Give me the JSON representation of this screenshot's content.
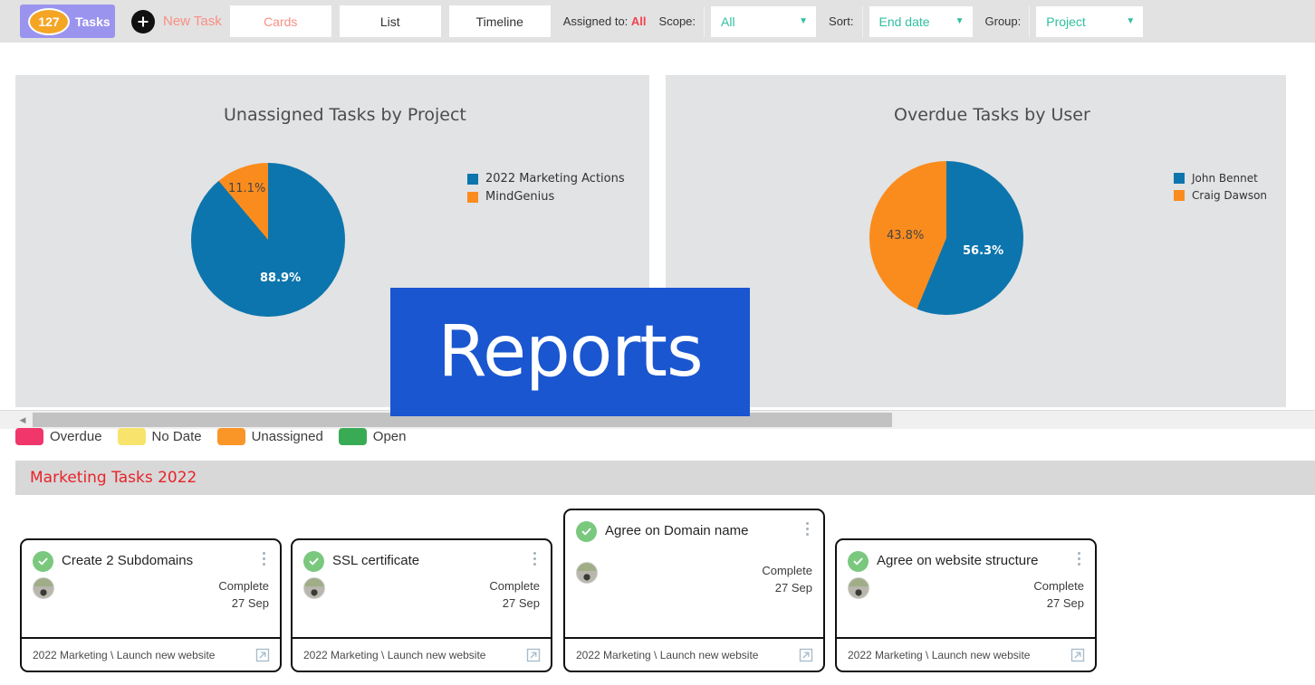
{
  "toolbar": {
    "tasks_count": "127",
    "tasks_label": "Tasks",
    "plus_icon": "plus-icon",
    "new_task_label": "New Task",
    "views": [
      {
        "label": "Cards",
        "active": true
      },
      {
        "label": "List",
        "active": false
      },
      {
        "label": "Timeline",
        "active": false
      }
    ],
    "assigned_to_label": "Assigned to:",
    "assigned_to_value": "All",
    "scope_label": "Scope:",
    "scope_value": "All",
    "sort_label": "Sort:",
    "sort_value": "End date",
    "group_label": "Group:",
    "group_value": "Project",
    "caret_icon": "chevron-down-icon",
    "colors": {
      "bar": "#e2e2e2",
      "badge": "#9b94ee",
      "count_circle": "#f5a524",
      "accent_salmon": "#fa8f84",
      "accent_red": "#f4414e",
      "select_text": "#2fbfa0"
    }
  },
  "chart_data": [
    {
      "type": "pie",
      "title": "Unassigned Tasks by Project",
      "labels": [
        "2022 Marketing Actions",
        "MindGenius"
      ],
      "values": [
        88.9,
        11.1
      ],
      "value_labels": [
        "88.9%",
        "11.1%"
      ],
      "colors": [
        "#0d75ad",
        "#fa8c1e"
      ],
      "legend_position": "right",
      "grid": false
    },
    {
      "type": "pie",
      "title": "Overdue Tasks by User",
      "labels": [
        "John Bennet",
        "Craig Dawson"
      ],
      "values": [
        56.3,
        43.8
      ],
      "value_labels": [
        "56.3%",
        "43.8%"
      ],
      "colors": [
        "#0d75ad",
        "#fa8c1e"
      ],
      "legend_position": "right",
      "grid": false
    }
  ],
  "overlay": {
    "text": "Reports",
    "color": "#1a56cf"
  },
  "scrollbar": {
    "left_arrow_icon": "caret-left-icon"
  },
  "status_legend": [
    {
      "label": "Overdue",
      "color": "#f0366b"
    },
    {
      "label": "No Date",
      "color": "#f8e46c"
    },
    {
      "label": "Unassigned",
      "color": "#f99627"
    },
    {
      "label": "Open",
      "color": "#3aab55"
    }
  ],
  "group": {
    "title": "Marketing Tasks 2022"
  },
  "cards": [
    {
      "title": "Create 2 Subdomains",
      "status": "Complete",
      "date": "27 Sep",
      "path": "2022 Marketing \\ Launch new website",
      "check_icon": "check-circle-icon",
      "kebab_icon": "more-vertical-icon",
      "open_icon": "open-external-icon",
      "avatar_icon": "avatar"
    },
    {
      "title": "SSL certificate",
      "status": "Complete",
      "date": "27 Sep",
      "path": "2022 Marketing \\ Launch new website",
      "check_icon": "check-circle-icon",
      "kebab_icon": "more-vertical-icon",
      "open_icon": "open-external-icon",
      "avatar_icon": "avatar"
    },
    {
      "title": "Agree on Domain name",
      "status": "Complete",
      "date": "27 Sep",
      "path": "2022 Marketing \\ Launch new website",
      "check_icon": "check-circle-icon",
      "kebab_icon": "more-vertical-icon",
      "open_icon": "open-external-icon",
      "avatar_icon": "avatar"
    },
    {
      "title": "Agree on website structure",
      "status": "Complete",
      "date": "27 Sep",
      "path": "2022 Marketing \\ Launch new website",
      "check_icon": "check-circle-icon",
      "kebab_icon": "more-vertical-icon",
      "open_icon": "open-external-icon",
      "avatar_icon": "avatar"
    }
  ]
}
